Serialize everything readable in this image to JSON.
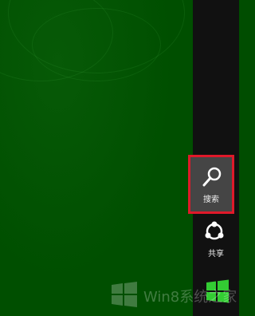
{
  "charms": {
    "search": {
      "label": "搜索",
      "icon": "search-icon",
      "highlight_color": "#e0192a"
    },
    "share": {
      "label": "共享",
      "icon": "share-icon"
    },
    "start": {
      "icon": "windows-logo-icon",
      "color": "#33cc33"
    }
  },
  "watermark": {
    "text": "Win8系统之家"
  },
  "colors": {
    "desktop": "#004f00",
    "charms_bar": "#111111"
  }
}
